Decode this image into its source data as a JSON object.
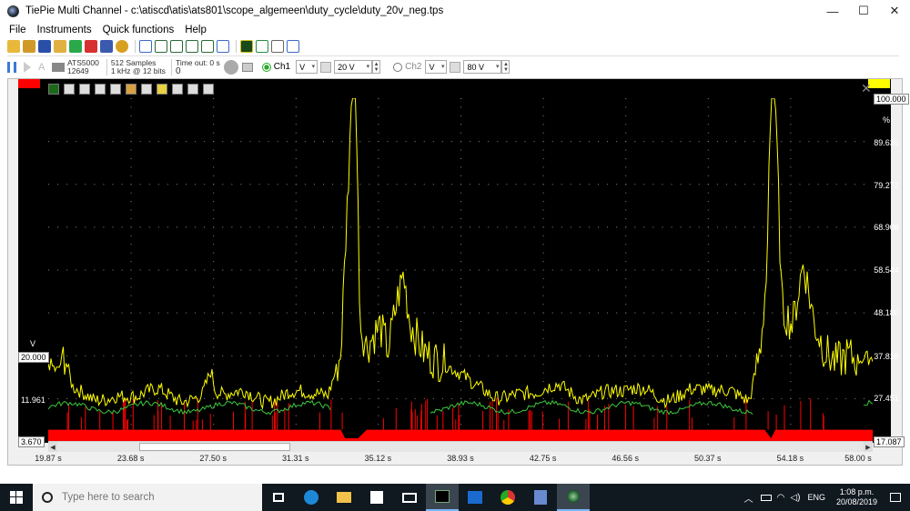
{
  "window": {
    "title": "TiePie Multi Channel - c:\\atiscd\\atis\\ats801\\scope_algemeen\\duty_cycle\\duty_20v_neg.tps",
    "minimize": "—",
    "maximize": "☐",
    "close": "✕"
  },
  "menu": {
    "items": [
      "File",
      "Instruments",
      "Quick functions",
      "Help"
    ]
  },
  "instrument": {
    "model": "ATS5000",
    "serial": "12649",
    "samples": "512 Samples",
    "rate": "1 kHz @ 12 bits",
    "timeout_label": "Time out: 0 s",
    "timeout_value": "0",
    "ch1": {
      "label": "Ch1",
      "coupling": "V",
      "range": "20 V"
    },
    "ch2": {
      "label": "Ch2",
      "coupling": "V",
      "range": "80 V"
    }
  },
  "scope": {
    "zoom_label": "1",
    "close_glyph": "✕",
    "left_axis": {
      "unit": "V",
      "top_marker": "20.000",
      "mid_value": "11.961",
      "bottom_marker": "3.670"
    },
    "right_axis": {
      "top_marker": "100.000",
      "unit": "%",
      "ticks": [
        "89.636",
        "79.272",
        "68.908",
        "58.544",
        "48.180",
        "37.816",
        "27.451"
      ],
      "bottom_marker": "17.087"
    },
    "x_ticks": [
      "19.87 s",
      "23.68 s",
      "27.50 s",
      "31.31 s",
      "35.12 s",
      "38.93 s",
      "42.75 s",
      "46.56 s",
      "50.37 s",
      "54.18 s",
      "58.00 s"
    ],
    "colors": {
      "ch1": "#ff0000",
      "ch2": "#ffff00",
      "ch2_low": "#3cc83c",
      "grid": "#8a8a8a",
      "background": "#000000"
    }
  },
  "chart_data": {
    "type": "line",
    "x_range": [
      19.87,
      58.0
    ],
    "series": [
      {
        "axis": "left",
        "values_note": "",
        "x": [
          19.87,
          33.0,
          33.4,
          33.6,
          34.2,
          34.6,
          53.0,
          53.3,
          53.5,
          58.0
        ],
        "y": [
          5.9,
          5.9,
          5.9,
          4.2,
          4.2,
          5.9,
          5.9,
          4.2,
          5.9,
          5.9
        ]
      },
      {
        "axis": "right",
        "x": [
          19.87,
          20.3,
          20.6,
          21.0,
          22.0,
          23.0,
          24.0,
          25.0,
          26.0,
          27.0,
          27.4,
          27.6,
          28.0,
          29.0,
          30.0,
          31.0,
          32.0,
          32.8,
          33.4,
          33.9,
          34.1,
          34.3,
          34.6,
          35.2,
          35.6,
          36.0,
          36.3,
          36.6,
          37.2,
          38.0,
          38.8,
          39.5,
          40.5,
          41.5,
          42.5,
          43.5,
          44.5,
          45.5,
          46.5,
          47.5,
          48.5,
          49.5,
          50.5,
          51.5,
          52.3,
          52.8,
          53.1,
          53.3,
          53.5,
          53.8,
          54.3,
          54.8,
          55.3,
          55.8,
          56.3,
          56.8,
          57.3,
          58.0
        ],
        "y": [
          36,
          33,
          37,
          29,
          27.5,
          29,
          27,
          29,
          27.5,
          29,
          34,
          28.5,
          27,
          29,
          27.5,
          29,
          27.5,
          28,
          39,
          100,
          100,
          46,
          40,
          44,
          38,
          50,
          57,
          46,
          40,
          37,
          33,
          30,
          28,
          29.5,
          28,
          30,
          28,
          29.5,
          28,
          29.5,
          28,
          29.5,
          28,
          29.5,
          28,
          40,
          58,
          100,
          100,
          48,
          44,
          60,
          46,
          40,
          37,
          38,
          36,
          36
        ]
      }
    ]
  },
  "taskbar": {
    "search_placeholder": "Type here to search",
    "language": "ENG",
    "time": "1:08 p.m.",
    "date": "20/08/2019"
  }
}
